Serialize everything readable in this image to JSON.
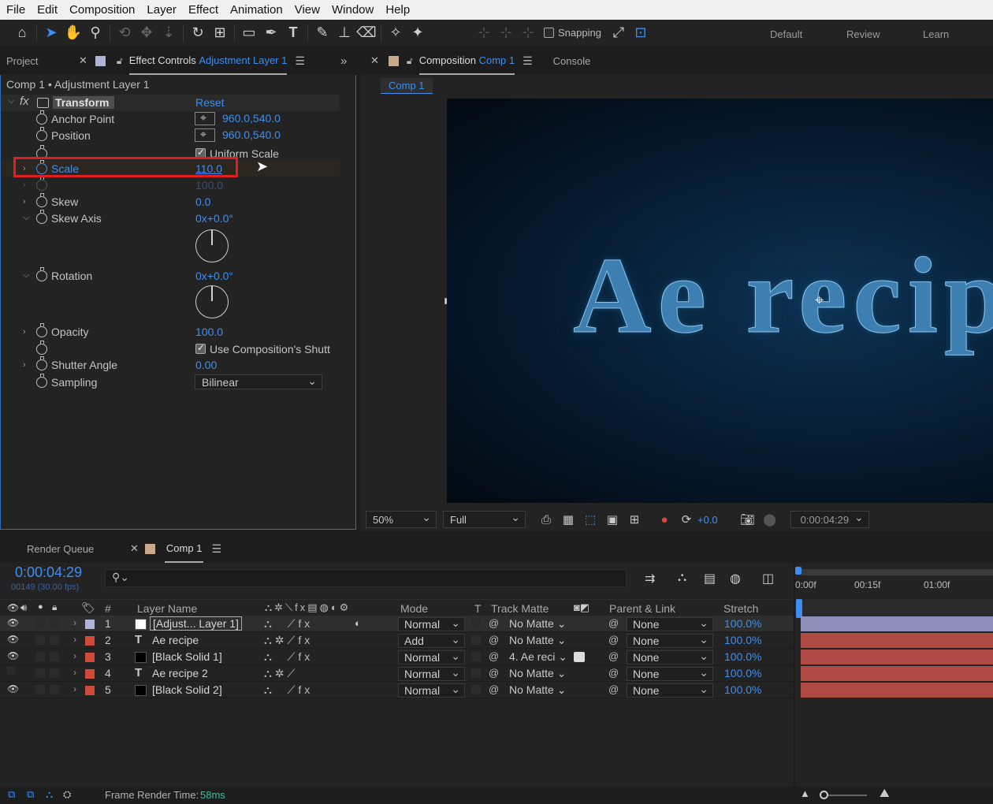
{
  "menu": [
    "File",
    "Edit",
    "Composition",
    "Layer",
    "Effect",
    "Animation",
    "View",
    "Window",
    "Help"
  ],
  "toolbar": {
    "snapping_label": "Snapping",
    "workspaces": [
      "Default",
      "Review",
      "Learn"
    ]
  },
  "left_panel": {
    "project_tab": "Project",
    "effect_controls_tab": "Effect Controls",
    "effect_controls_layer": "Adjustment Layer 1",
    "breadcrumb": "Comp 1 • Adjustment Layer 1",
    "effect_name": "Transform",
    "reset_label": "Reset",
    "properties": {
      "anchor_point": {
        "label": "Anchor Point",
        "value": "960.0,540.0"
      },
      "position": {
        "label": "Position",
        "value": "960.0,540.0"
      },
      "uniform_scale": {
        "label": "Uniform Scale"
      },
      "scale": {
        "label": "Scale",
        "value": "110.0"
      },
      "scale_width": {
        "value": "100.0"
      },
      "skew": {
        "label": "Skew",
        "value": "0.0"
      },
      "skew_axis": {
        "label": "Skew Axis",
        "value": "0x+0.0°"
      },
      "rotation": {
        "label": "Rotation",
        "value": "0x+0.0°"
      },
      "opacity": {
        "label": "Opacity",
        "value": "100.0"
      },
      "use_comp_shutter": {
        "label": "Use Composition's Shutt"
      },
      "shutter_angle": {
        "label": "Shutter Angle",
        "value": "0.00"
      },
      "sampling": {
        "label": "Sampling",
        "value": "Bilinear"
      }
    }
  },
  "comp_panel": {
    "tab_label": "Composition",
    "comp_name": "Comp 1",
    "console_tab": "Console",
    "subtab": "Comp 1",
    "preview_text": "Ae recip",
    "zoom": "50%",
    "resolution": "Full",
    "exposure": "+0.0",
    "timecode": "0:00:04:29"
  },
  "timeline": {
    "render_queue_tab": "Render Queue",
    "comp_tab": "Comp 1",
    "current_time": "0:00:04:29",
    "frame_info": "00149 (30.00 fps)",
    "search_placeholder": "",
    "ruler": [
      "0:00f",
      "00:15f",
      "01:00f"
    ],
    "columns": {
      "num": "#",
      "layer_name": "Layer Name",
      "mode": "Mode",
      "t": "T",
      "track_matte": "Track Matte",
      "parent": "Parent & Link",
      "stretch": "Stretch"
    },
    "layers": [
      {
        "num": "1",
        "name": "[Adjust... Layer 1]",
        "mode": "Normal",
        "matte": "No Matte",
        "parent": "None",
        "stretch": "100.0%",
        "label_color": "#b0b2d8",
        "icon": "white-solid",
        "visible": true
      },
      {
        "num": "2",
        "name": "Ae recipe",
        "mode": "Add",
        "matte": "No Matte",
        "parent": "None",
        "stretch": "100.0%",
        "label_color": "#d04a3a",
        "icon": "text",
        "visible": true
      },
      {
        "num": "3",
        "name": "[Black Solid 1]",
        "mode": "Normal",
        "matte": "4. Ae reci",
        "parent": "None",
        "stretch": "100.0%",
        "label_color": "#d04a3a",
        "icon": "black-solid",
        "visible": true
      },
      {
        "num": "4",
        "name": "Ae recipe 2",
        "mode": "Normal",
        "matte": "No Matte",
        "parent": "None",
        "stretch": "100.0%",
        "label_color": "#d04a3a",
        "icon": "text",
        "visible": false
      },
      {
        "num": "5",
        "name": "[Black Solid 2]",
        "mode": "Normal",
        "matte": "No Matte",
        "parent": "None",
        "stretch": "100.0%",
        "label_color": "#d04a3a",
        "icon": "black-solid",
        "visible": true
      }
    ],
    "status_label": "Frame Render Time:",
    "status_value": "58ms"
  }
}
